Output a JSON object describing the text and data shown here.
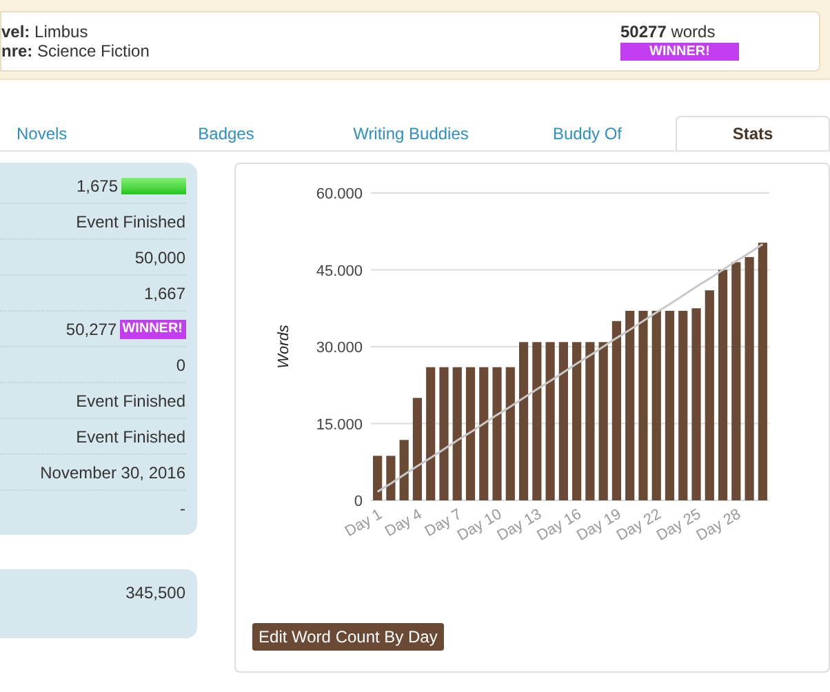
{
  "novel": {
    "fields": [
      {
        "label": "vel:",
        "value": "Limbus"
      },
      {
        "label": "nre:",
        "value": "Science Fiction"
      }
    ],
    "word_count": "50277",
    "word_unit": "words",
    "badge": "WINNER!"
  },
  "tabs": [
    {
      "label": "Novels",
      "selected": false
    },
    {
      "label": "Badges",
      "selected": false
    },
    {
      "label": "Writing Buddies",
      "selected": false
    },
    {
      "label": "Buddy Of",
      "selected": false
    },
    {
      "label": "Stats",
      "selected": true
    }
  ],
  "stats_panel": {
    "rows": [
      {
        "kind": "progress",
        "value": "1,675",
        "level": 1
      },
      {
        "kind": "text",
        "value": "Event Finished"
      },
      {
        "kind": "text",
        "value": "50,000"
      },
      {
        "kind": "text",
        "value": "1,667"
      },
      {
        "kind": "badge",
        "value": "50,277",
        "badge": "WINNER!"
      },
      {
        "kind": "text",
        "value": "0"
      },
      {
        "kind": "text",
        "value": "Event Finished"
      },
      {
        "kind": "text",
        "value": "Event Finished"
      },
      {
        "kind": "text",
        "value": "November 30, 2016"
      },
      {
        "kind": "text",
        "value": "-"
      }
    ]
  },
  "totals_panel": {
    "rows": [
      {
        "value": "345,500"
      }
    ]
  },
  "chart": {
    "chart_data": {
      "type": "bar",
      "ylabel": "Words",
      "categories": [
        "Day 1",
        null,
        null,
        "Day 4",
        null,
        null,
        "Day 7",
        null,
        null,
        "Day 10",
        null,
        null,
        "Day 13",
        null,
        null,
        "Day 16",
        null,
        null,
        "Day 19",
        null,
        null,
        "Day 22",
        null,
        null,
        "Day 25",
        null,
        null,
        "Day 28",
        null,
        null
      ],
      "grid": true,
      "ylim": [
        0,
        60000
      ],
      "yticks": [
        {
          "value": 0,
          "label": "0"
        },
        {
          "value": 15000,
          "label": "15.000"
        },
        {
          "value": 30000,
          "label": "30.000"
        },
        {
          "value": 45000,
          "label": "45.000"
        },
        {
          "value": 60000,
          "label": "60.000"
        }
      ],
      "series": [
        {
          "type": "bar",
          "color": "#6b4a35",
          "values": [
            8700,
            8700,
            11800,
            20000,
            26000,
            26000,
            26000,
            26000,
            26000,
            26000,
            26000,
            30900,
            30900,
            30900,
            30900,
            30900,
            30900,
            30900,
            35000,
            37000,
            37000,
            37000,
            37000,
            37000,
            37500,
            41000,
            45000,
            46500,
            47500,
            50300
          ]
        },
        {
          "type": "line",
          "color": "#c8c8c8",
          "values": [
            1700,
            3300,
            5000,
            6700,
            8300,
            10000,
            11700,
            13300,
            15000,
            16700,
            18300,
            20000,
            21700,
            23300,
            25000,
            26700,
            28300,
            30000,
            31700,
            33300,
            35000,
            36700,
            38300,
            40000,
            41700,
            43300,
            45000,
            46700,
            48300,
            50000
          ]
        }
      ]
    },
    "button": "Edit Word Count By Day"
  }
}
